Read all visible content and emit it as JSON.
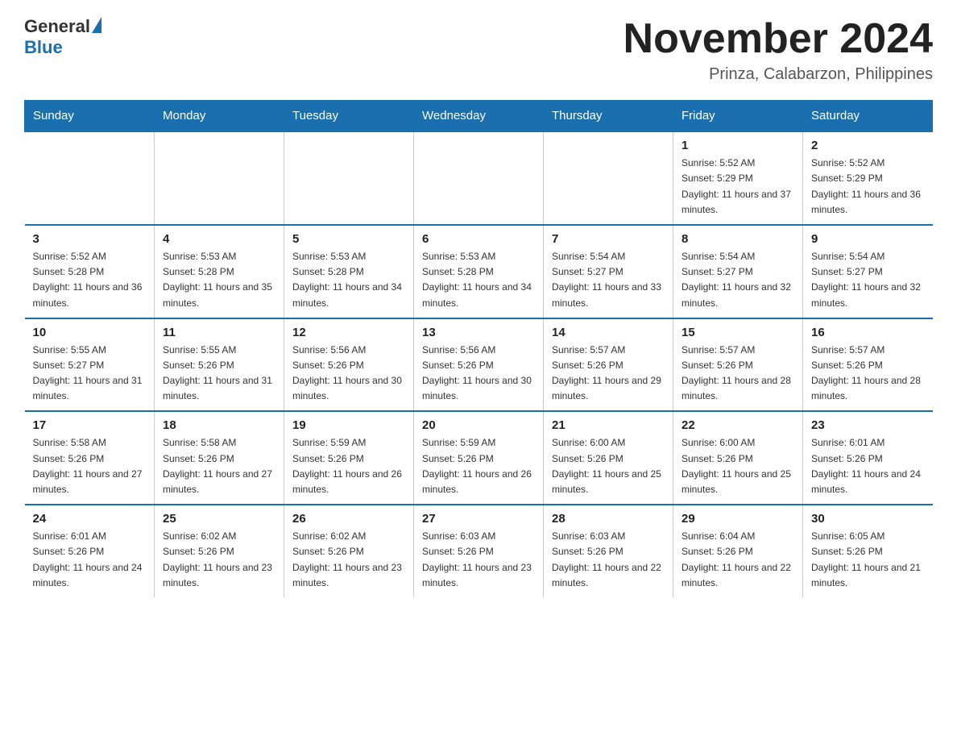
{
  "logo": {
    "general": "General",
    "blue": "Blue"
  },
  "title": "November 2024",
  "location": "Prinza, Calabarzon, Philippines",
  "days_of_week": [
    "Sunday",
    "Monday",
    "Tuesday",
    "Wednesday",
    "Thursday",
    "Friday",
    "Saturday"
  ],
  "weeks": [
    [
      {
        "day": "",
        "info": ""
      },
      {
        "day": "",
        "info": ""
      },
      {
        "day": "",
        "info": ""
      },
      {
        "day": "",
        "info": ""
      },
      {
        "day": "",
        "info": ""
      },
      {
        "day": "1",
        "info": "Sunrise: 5:52 AM\nSunset: 5:29 PM\nDaylight: 11 hours and 37 minutes."
      },
      {
        "day": "2",
        "info": "Sunrise: 5:52 AM\nSunset: 5:29 PM\nDaylight: 11 hours and 36 minutes."
      }
    ],
    [
      {
        "day": "3",
        "info": "Sunrise: 5:52 AM\nSunset: 5:28 PM\nDaylight: 11 hours and 36 minutes."
      },
      {
        "day": "4",
        "info": "Sunrise: 5:53 AM\nSunset: 5:28 PM\nDaylight: 11 hours and 35 minutes."
      },
      {
        "day": "5",
        "info": "Sunrise: 5:53 AM\nSunset: 5:28 PM\nDaylight: 11 hours and 34 minutes."
      },
      {
        "day": "6",
        "info": "Sunrise: 5:53 AM\nSunset: 5:28 PM\nDaylight: 11 hours and 34 minutes."
      },
      {
        "day": "7",
        "info": "Sunrise: 5:54 AM\nSunset: 5:27 PM\nDaylight: 11 hours and 33 minutes."
      },
      {
        "day": "8",
        "info": "Sunrise: 5:54 AM\nSunset: 5:27 PM\nDaylight: 11 hours and 32 minutes."
      },
      {
        "day": "9",
        "info": "Sunrise: 5:54 AM\nSunset: 5:27 PM\nDaylight: 11 hours and 32 minutes."
      }
    ],
    [
      {
        "day": "10",
        "info": "Sunrise: 5:55 AM\nSunset: 5:27 PM\nDaylight: 11 hours and 31 minutes."
      },
      {
        "day": "11",
        "info": "Sunrise: 5:55 AM\nSunset: 5:26 PM\nDaylight: 11 hours and 31 minutes."
      },
      {
        "day": "12",
        "info": "Sunrise: 5:56 AM\nSunset: 5:26 PM\nDaylight: 11 hours and 30 minutes."
      },
      {
        "day": "13",
        "info": "Sunrise: 5:56 AM\nSunset: 5:26 PM\nDaylight: 11 hours and 30 minutes."
      },
      {
        "day": "14",
        "info": "Sunrise: 5:57 AM\nSunset: 5:26 PM\nDaylight: 11 hours and 29 minutes."
      },
      {
        "day": "15",
        "info": "Sunrise: 5:57 AM\nSunset: 5:26 PM\nDaylight: 11 hours and 28 minutes."
      },
      {
        "day": "16",
        "info": "Sunrise: 5:57 AM\nSunset: 5:26 PM\nDaylight: 11 hours and 28 minutes."
      }
    ],
    [
      {
        "day": "17",
        "info": "Sunrise: 5:58 AM\nSunset: 5:26 PM\nDaylight: 11 hours and 27 minutes."
      },
      {
        "day": "18",
        "info": "Sunrise: 5:58 AM\nSunset: 5:26 PM\nDaylight: 11 hours and 27 minutes."
      },
      {
        "day": "19",
        "info": "Sunrise: 5:59 AM\nSunset: 5:26 PM\nDaylight: 11 hours and 26 minutes."
      },
      {
        "day": "20",
        "info": "Sunrise: 5:59 AM\nSunset: 5:26 PM\nDaylight: 11 hours and 26 minutes."
      },
      {
        "day": "21",
        "info": "Sunrise: 6:00 AM\nSunset: 5:26 PM\nDaylight: 11 hours and 25 minutes."
      },
      {
        "day": "22",
        "info": "Sunrise: 6:00 AM\nSunset: 5:26 PM\nDaylight: 11 hours and 25 minutes."
      },
      {
        "day": "23",
        "info": "Sunrise: 6:01 AM\nSunset: 5:26 PM\nDaylight: 11 hours and 24 minutes."
      }
    ],
    [
      {
        "day": "24",
        "info": "Sunrise: 6:01 AM\nSunset: 5:26 PM\nDaylight: 11 hours and 24 minutes."
      },
      {
        "day": "25",
        "info": "Sunrise: 6:02 AM\nSunset: 5:26 PM\nDaylight: 11 hours and 23 minutes."
      },
      {
        "day": "26",
        "info": "Sunrise: 6:02 AM\nSunset: 5:26 PM\nDaylight: 11 hours and 23 minutes."
      },
      {
        "day": "27",
        "info": "Sunrise: 6:03 AM\nSunset: 5:26 PM\nDaylight: 11 hours and 23 minutes."
      },
      {
        "day": "28",
        "info": "Sunrise: 6:03 AM\nSunset: 5:26 PM\nDaylight: 11 hours and 22 minutes."
      },
      {
        "day": "29",
        "info": "Sunrise: 6:04 AM\nSunset: 5:26 PM\nDaylight: 11 hours and 22 minutes."
      },
      {
        "day": "30",
        "info": "Sunrise: 6:05 AM\nSunset: 5:26 PM\nDaylight: 11 hours and 21 minutes."
      }
    ]
  ]
}
